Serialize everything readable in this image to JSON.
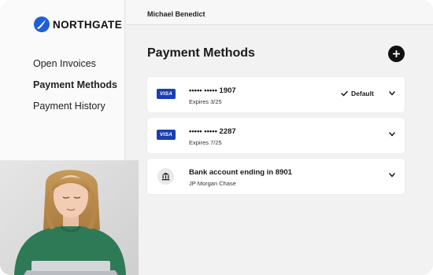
{
  "app": {
    "brand": "NORTHGATE"
  },
  "sidebar": {
    "items": [
      {
        "label": "Open Invoices",
        "active": false
      },
      {
        "label": "Payment Methods",
        "active": true
      },
      {
        "label": "Payment History",
        "active": false
      }
    ]
  },
  "header": {
    "user": "Michael Benedict"
  },
  "main": {
    "title": "Payment Methods",
    "methods": [
      {
        "type": "card",
        "brand": "VISA",
        "number": "••••• ••••• 1907",
        "sub": "Expires 3/25",
        "default_label": "Default"
      },
      {
        "type": "card",
        "brand": "VISA",
        "number": "••••• ••••• 2287",
        "sub": "Expires 7/25"
      },
      {
        "type": "bank",
        "number": "Bank account ending in 8901",
        "sub": "JP Morgan Chase"
      }
    ]
  },
  "icons": {
    "logo": "northgate-logo-icon",
    "add": "plus-icon",
    "default": "checkmark-icon",
    "expand": "chevron-down-icon",
    "bank": "bank-building-icon"
  },
  "colors": {
    "brand_blue": "#1f5fd6",
    "visa_blue": "#1a3fb0",
    "add_button": "#111111"
  }
}
